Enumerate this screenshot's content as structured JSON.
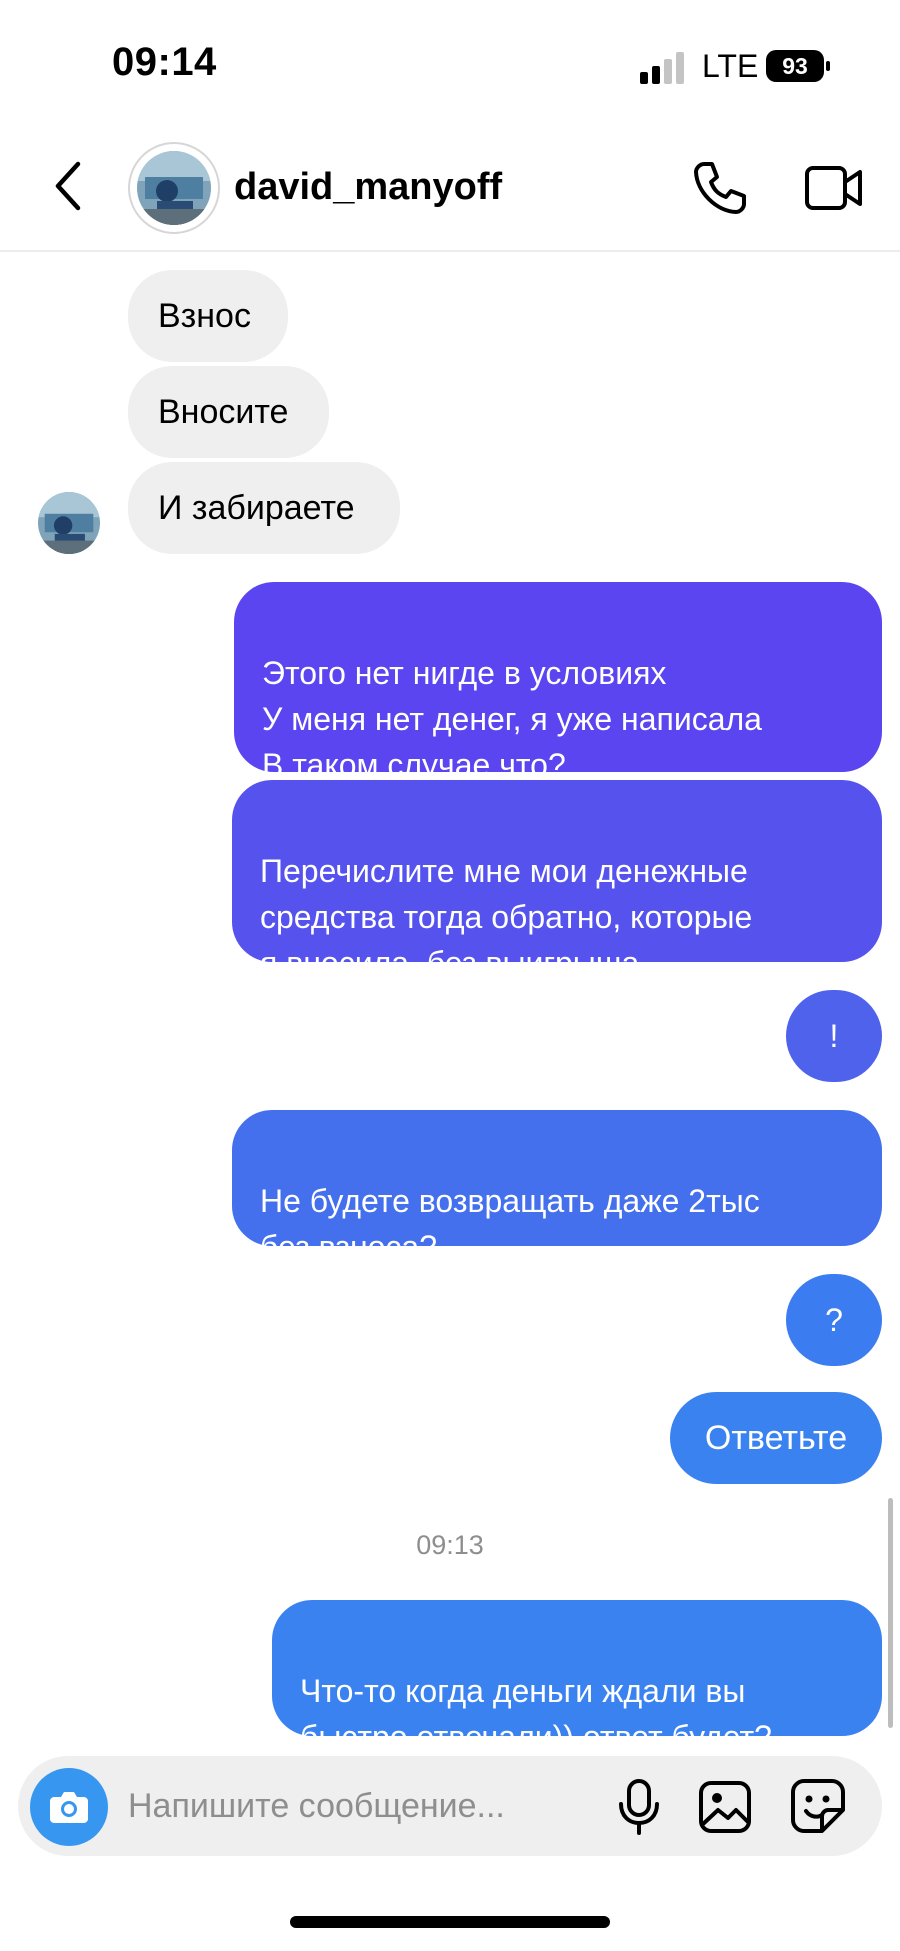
{
  "status_bar": {
    "time": "09:14",
    "network": "LTE",
    "battery": "93"
  },
  "header": {
    "username": "david_manyoff",
    "back_icon": "chevron-left-icon",
    "call_icon": "phone-icon",
    "video_icon": "video-camera-icon"
  },
  "incoming": [
    {
      "text": "Взнос"
    },
    {
      "text": "Вносите"
    },
    {
      "text": "И забираете"
    }
  ],
  "outgoing": [
    {
      "text": "Этого нет нигде в условиях\nУ меня нет денег, я уже написала\nВ таком случае что?",
      "color": "#5b45f0"
    },
    {
      "text": "Перечислите мне мои денежные\nсредства тогда обратно, которые\nя вносила, без выигрыша",
      "color": "#5552ee"
    },
    {
      "text": "!",
      "color": "#4f62ec"
    },
    {
      "text": "Не будете возвращать даже 2тыс\nбез взноса?",
      "color": "#4470ee"
    },
    {
      "text": "?",
      "color": "#3b7cf0"
    },
    {
      "text": "Ответьте",
      "color": "#3b82f1"
    },
    {
      "text": "Что-то когда деньги ждали вы\nбыстро отвечали)) ответ будет?",
      "color": "#3b82f1"
    }
  ],
  "timestamp": "09:13",
  "composer": {
    "placeholder": "Напишите сообщение...",
    "accent": "#3797f0"
  }
}
